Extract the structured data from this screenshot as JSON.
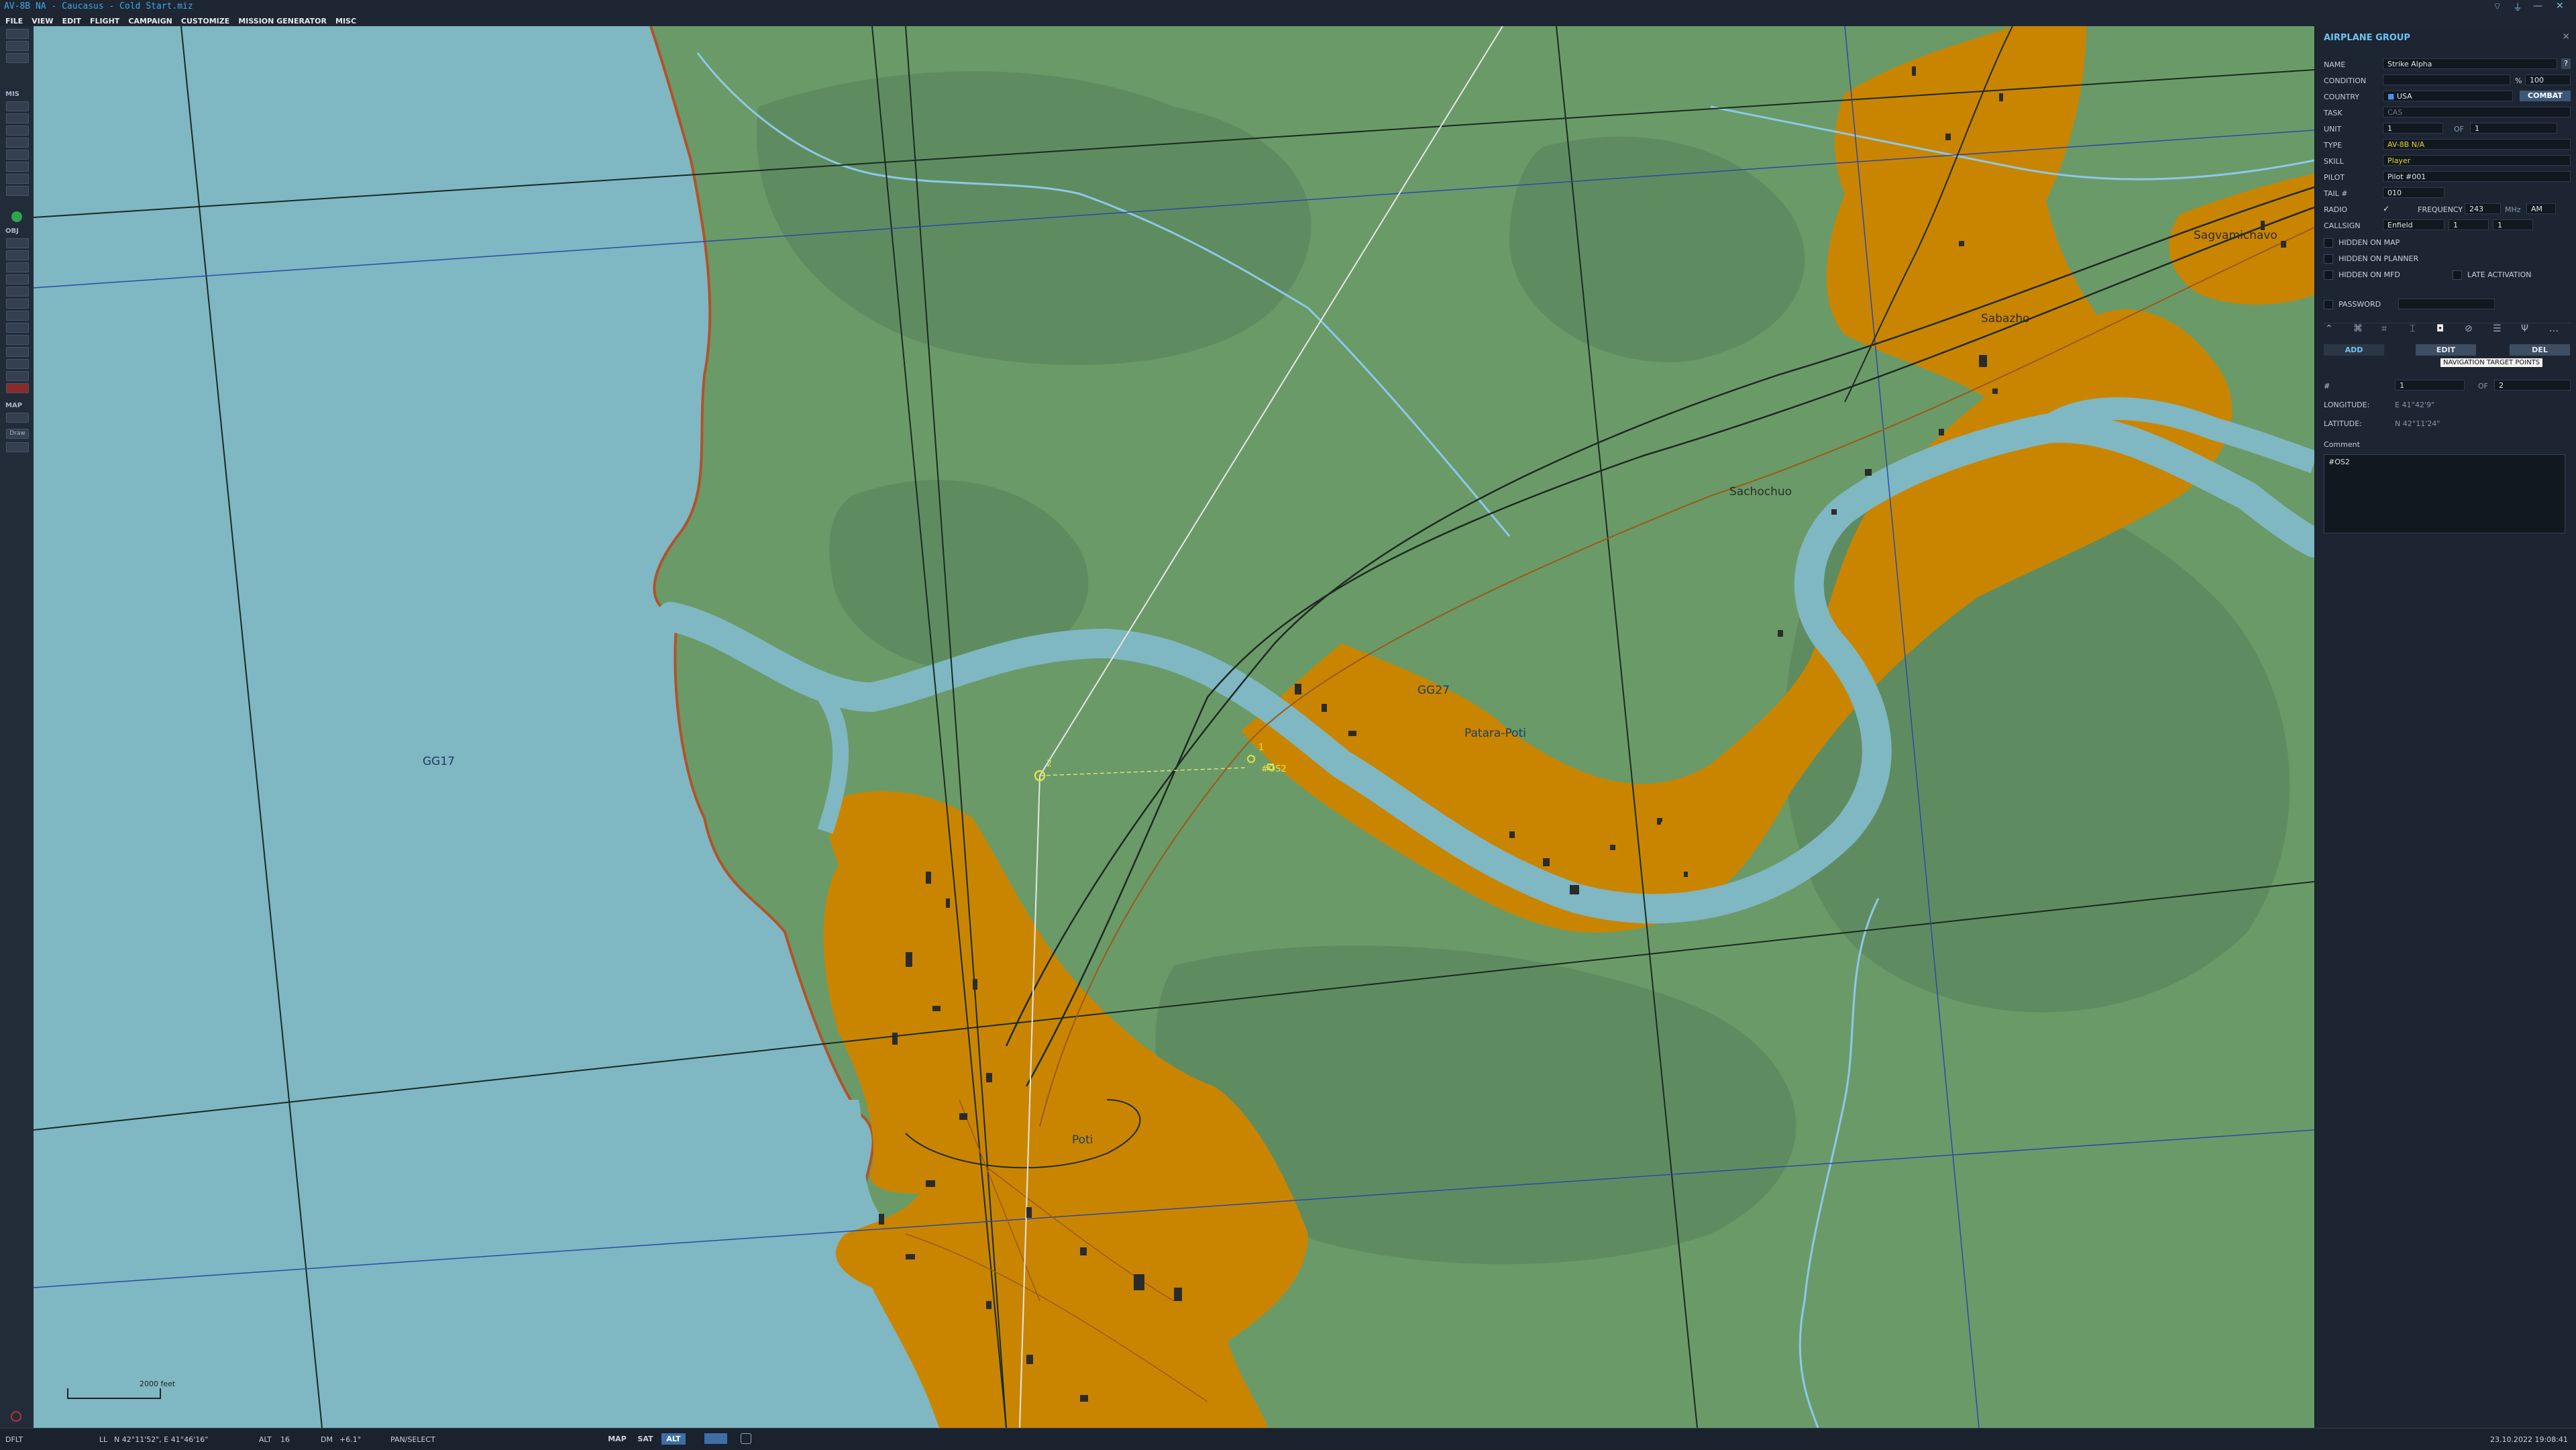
{
  "window": {
    "title": "AV-8B NA - Caucasus - Cold Start.miz",
    "minimize_glyph": "—",
    "close_glyph": "✕"
  },
  "menu": [
    "FILE",
    "VIEW",
    "EDIT",
    "FLIGHT",
    "CAMPAIGN",
    "CUSTOMIZE",
    "MISSION GENERATOR",
    "MISC"
  ],
  "toolbar": {
    "sections": {
      "mis": "MIS",
      "obj": "OBJ",
      "map": "MAP"
    },
    "draw_label": "Draw"
  },
  "map": {
    "labels": {
      "grid_gg17": "GG17",
      "grid_gg27": "GG27",
      "patara_poti": "Patara-Poti",
      "sachochuo": "Sachochuo",
      "sabazho": "Sabazho",
      "sagvamichavo": "Sagvamichavo",
      "poti": "Poti"
    },
    "waypoints": {
      "wp2_label": "2",
      "wp1_label": "1",
      "target_label": "#OS2"
    },
    "scale": "2000 feet",
    "colors": {
      "water": "#7fb7c2",
      "land": "#6a9a68",
      "forest": "#5e8c60",
      "urban": "#c98500"
    }
  },
  "panel": {
    "header": "AIRPLANE GROUP",
    "help_glyph": "?",
    "fields": {
      "name_label": "NAME",
      "name_value": "Strike Alpha",
      "condition_label": "CONDITION",
      "condition_value": "100",
      "condition_unit": "%",
      "country_label": "COUNTRY",
      "country_value": "USA",
      "combat_button": "COMBAT",
      "task_label": "TASK",
      "task_value": "CAS",
      "unit_label": "UNIT",
      "unit_value": "1",
      "unit_of_label": "OF",
      "unit_of_value": "1",
      "type_label": "TYPE",
      "type_value": "AV-8B N/A",
      "skill_label": "SKILL",
      "skill_value": "Player",
      "pilot_label": "PILOT",
      "pilot_value": "Pilot #001",
      "tail_label": "TAIL #",
      "tail_value": "010",
      "radio_label": "RADIO",
      "radio_check": "✓",
      "frequency_label": "FREQUENCY",
      "frequency_value": "243",
      "frequency_unit": "MHz",
      "modulation": "AM",
      "callsign_label": "CALLSIGN",
      "callsign_value": "Enfield",
      "callsign_num1": "1",
      "callsign_num2": "1"
    },
    "checks": {
      "hidden_on_map": "HIDDEN ON MAP",
      "hidden_on_planner": "HIDDEN ON PLANNER",
      "hidden_on_mfd": "HIDDEN ON MFD",
      "late_activation": "LATE ACTIVATION",
      "password": "PASSWORD"
    },
    "buttons": {
      "add": "ADD",
      "edit": "EDIT",
      "del": "DEL"
    },
    "tooltip": "NAVIGATION TARGET POINTS",
    "target_point": {
      "hash_label": "#",
      "index_value": "1",
      "of_label": "OF",
      "of_value": "2",
      "longitude_label": "LONGITUDE:",
      "longitude_value": "E 41°42'9\"",
      "latitude_label": "LATITUDE:",
      "latitude_value": "N 42°11'24\"",
      "comment_label": "Comment",
      "comment_value": "#OS2"
    }
  },
  "status": {
    "profile": "DFLT",
    "ll_label": "LL",
    "ll_value": "N 42°11'52\", E 41°46'16\"",
    "alt_label": "ALT",
    "alt_value": "16",
    "dm_label": "DM",
    "dm_value": "+6.1°",
    "mode": "PAN/SELECT",
    "map_btn": "MAP",
    "sat_btn": "SAT",
    "alt_btn": "ALT",
    "datetime": "23.10.2022 19:08:41"
  }
}
